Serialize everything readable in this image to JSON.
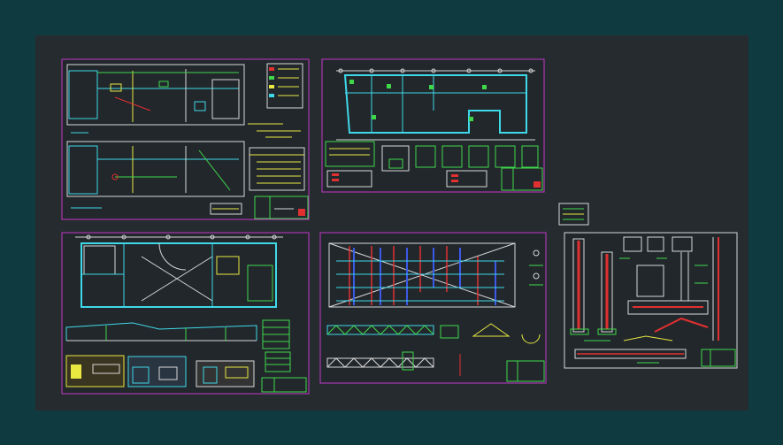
{
  "colors": {
    "outer_background": "#0f3a40",
    "model_space": "#262b30",
    "sheet_border_magenta": "#c43ac8",
    "sheet_border_white": "#d8d8d8",
    "walls_cyan": "#3fd8e8",
    "title_block_green": "#3fd84a",
    "dimension_yellow": "#e8e840",
    "section_red": "#e03030",
    "text_white": "#f0f0f0"
  },
  "sheets": [
    {
      "id": "electrical-plans",
      "kind": "plans"
    },
    {
      "id": "foundation-plan",
      "kind": "plans"
    },
    {
      "id": "architecture-plan-elevations",
      "kind": "plans"
    },
    {
      "id": "roof-framing-plan",
      "kind": "plans"
    },
    {
      "id": "structural-details",
      "kind": "details"
    }
  ]
}
